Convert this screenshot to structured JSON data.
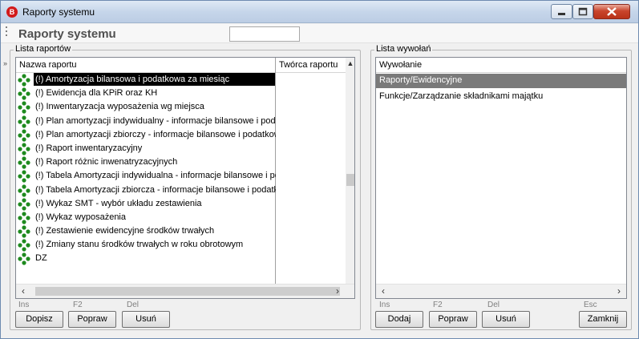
{
  "window": {
    "title": "Raporty systemu",
    "app_icon_letter": "B"
  },
  "header": {
    "title": "Raporty systemu",
    "search_value": ""
  },
  "reports_panel": {
    "label": "Lista raportów",
    "columns": [
      "Nazwa raportu",
      "Twórca raportu"
    ],
    "items": [
      "(!) Amortyzacja bilansowa i podatkowa za miesiąc",
      "(!) Ewidencja dla KPiR oraz KH",
      "(!) Inwentaryzacja wyposażenia wg miejsca",
      "(!) Plan amortyzacji indywidualny - informacje bilansowe i podatkowe",
      "(!) Plan amortyzacji zbiorczy - informacje bilansowe i podatkowe",
      "(!) Raport inwentaryzacyjny",
      "(!) Raport różnic inwenatryzacyjnych",
      "(!) Tabela Amortyzacji indywidualna - informacje bilansowe i podatkowe",
      "(!) Tabela Amortyzacji zbiorcza - informacje bilansowe i podatkowe",
      "(!) Wykaz SMT - wybór układu zestawienia",
      "(!) Wykaz wyposażenia",
      "(!) Zestawienie ewidencyjne środków trwałych",
      "(!) Zmiany stanu środków trwałych w roku obrotowym",
      "DZ"
    ],
    "selected_index": 0,
    "hints": {
      "ins": "Ins",
      "f2": "F2",
      "del": "Del"
    },
    "buttons": {
      "add": "Dopisz",
      "edit": "Popraw",
      "delete": "Usuń"
    }
  },
  "calls_panel": {
    "label": "Lista wywołań",
    "column": "Wywołanie",
    "items": [
      "Raporty/Ewidencyjne",
      "Funkcje/Zarządzanie składnikami majątku"
    ],
    "selected_index": 0,
    "hints": {
      "ins": "Ins",
      "f2": "F2",
      "del": "Del",
      "esc": "Esc"
    },
    "buttons": {
      "add": "Dodaj",
      "edit": "Popraw",
      "delete": "Usuń",
      "close": "Zamknij"
    }
  },
  "colors": {
    "tree_icon_green": "#1e8a1e",
    "selection_black": "#000000",
    "selection_gray": "#7a7a7a",
    "close_button_red": "#c9452c"
  }
}
